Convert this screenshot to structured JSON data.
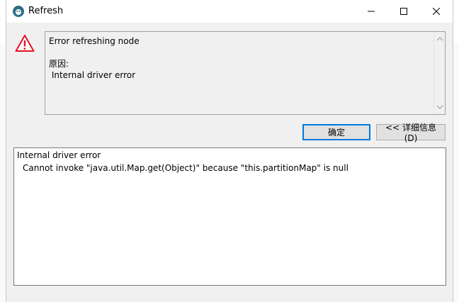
{
  "window": {
    "title": "Refresh",
    "controls": {
      "minimize_icon": "minimize-icon",
      "maximize_icon": "maximize-icon",
      "close_icon": "close-icon"
    }
  },
  "message": {
    "icon": "warning-icon",
    "title": "Error refreshing node",
    "reason_label": "原因:",
    "reason_text": "Internal driver error"
  },
  "buttons": {
    "ok_label": "确定",
    "details_label": "<< 详细信息(D)"
  },
  "details": {
    "line1": "Internal driver error",
    "line2": "Cannot invoke \"java.util.Map.get(Object)\" because \"this.partitionMap\" is null"
  },
  "colors": {
    "accent": "#0078d7",
    "warning": "#e81123",
    "dialog_bg": "#f0f0f0"
  }
}
